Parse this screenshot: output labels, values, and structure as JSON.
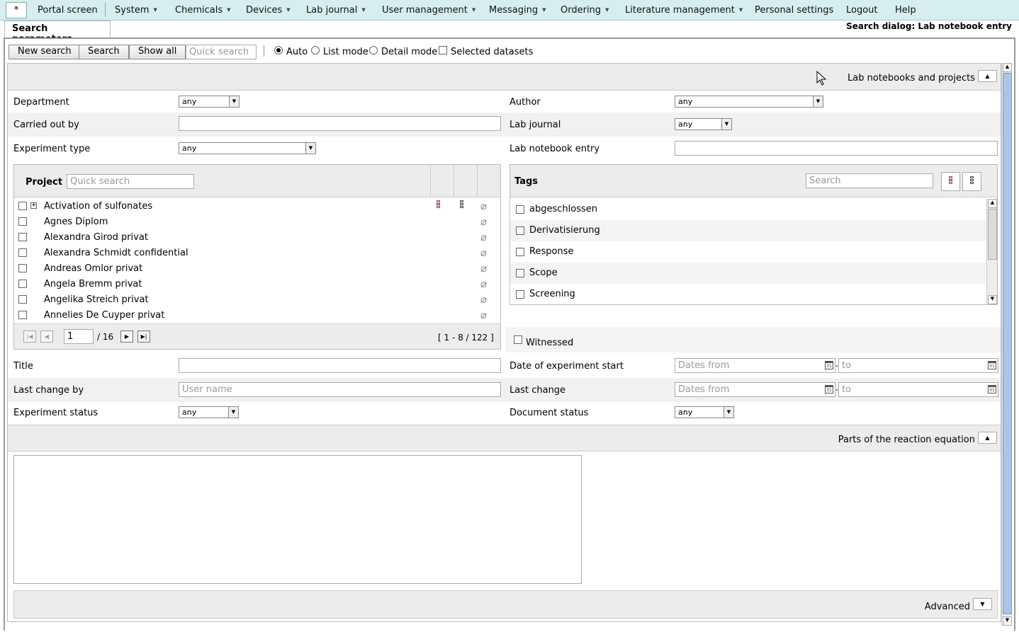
{
  "menu": {
    "home": "*",
    "items": [
      {
        "label": "Portal screen",
        "dropdown": false
      },
      {
        "label": "System",
        "dropdown": true
      },
      {
        "label": "Chemicals",
        "dropdown": true
      },
      {
        "label": "Devices",
        "dropdown": true
      },
      {
        "label": "Lab journal",
        "dropdown": true
      },
      {
        "label": "User management",
        "dropdown": true
      },
      {
        "label": "Messaging",
        "dropdown": true
      },
      {
        "label": "Ordering",
        "dropdown": true
      },
      {
        "label": "Literature management",
        "dropdown": true
      },
      {
        "label": "Personal settings",
        "dropdown": false
      },
      {
        "label": "Logout",
        "dropdown": false
      },
      {
        "label": "Help",
        "dropdown": false
      }
    ]
  },
  "tab": "Search parameters",
  "dialog_title": "Search dialog: Lab notebook entry",
  "toolbar": {
    "new_search": "New search",
    "search": "Search",
    "show_all": "Show all",
    "quick_search_placeholder": "Quick search",
    "auto": "Auto",
    "list_mode": "List mode",
    "detail_mode": "Detail mode",
    "selected_datasets": "Selected datasets",
    "selected_mode": "auto"
  },
  "section1": {
    "title": "Lab notebooks and projects",
    "department": {
      "label": "Department",
      "value": "any"
    },
    "author": {
      "label": "Author",
      "value": "any"
    },
    "carried_out_by": {
      "label": "Carried out by",
      "value": ""
    },
    "lab_journal": {
      "label": "Lab journal",
      "value": "any"
    },
    "experiment_type": {
      "label": "Experiment type",
      "value": "any"
    },
    "lab_notebook_entry": {
      "label": "Lab notebook entry",
      "value": ""
    },
    "project": {
      "label": "Project",
      "search_placeholder": "Quick search",
      "rows": [
        "Activation of sulfonates",
        "Agnes Diplom",
        "Alexandra Girod privat",
        "Alexandra Schmidt confidential",
        "Andreas Omlor privat",
        "Angela Bremm privat",
        "Angelika Streich privat",
        "Annelies De Cuyper privat"
      ],
      "page": "1",
      "page_total": "/ 16",
      "range": "[ 1 - 8 / 122 ]"
    },
    "tags": {
      "label": "Tags",
      "search_placeholder": "Search",
      "items": [
        "abgeschlossen",
        "Derivatisierung",
        "Response",
        "Scope",
        "Screening"
      ]
    },
    "witnessed": "Witnessed",
    "title_field": {
      "label": "Title",
      "value": ""
    },
    "date_start": {
      "label": "Date of experiment start",
      "from": "Dates from",
      "to": "to"
    },
    "last_change_by": {
      "label": "Last change by",
      "placeholder": "User name"
    },
    "last_change": {
      "label": "Last change",
      "from": "Dates from",
      "to": "to"
    },
    "experiment_status": {
      "label": "Experiment status",
      "value": "any"
    },
    "document_status": {
      "label": "Document status",
      "value": "any"
    }
  },
  "section2": {
    "title": "Parts of the reaction equation"
  },
  "advanced": {
    "title": "Advanced"
  }
}
